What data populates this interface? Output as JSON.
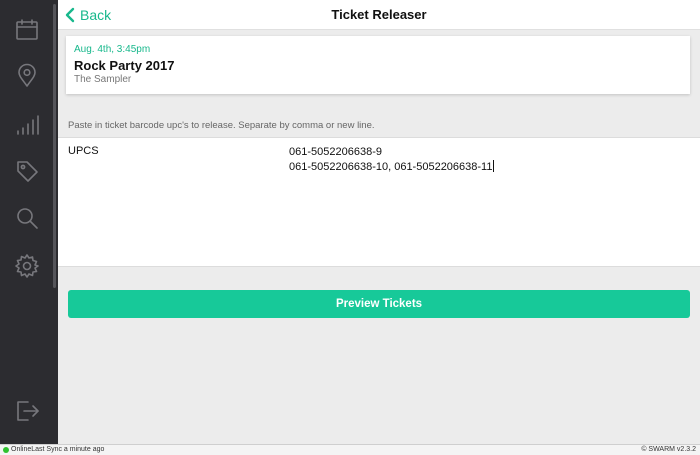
{
  "header": {
    "back_label": "Back",
    "title": "Ticket Releaser"
  },
  "event": {
    "date": "Aug. 4th, 3:45pm",
    "name": "Rock Party 2017",
    "venue": "The Sampler"
  },
  "upc": {
    "instructions": "Paste in ticket barcode upc's to release. Separate by comma or new line.",
    "label": "UPCS",
    "lines": [
      "061-5052206638-9",
      "061-5052206638-10, 061-5052206638-11"
    ]
  },
  "actions": {
    "preview_label": "Preview Tickets"
  },
  "status": {
    "connection": "Online",
    "last_sync": "Last Sync a minute ago",
    "version": "© SWARM v2.3.2"
  },
  "sidebar": {
    "icons": [
      "calendar-icon",
      "location-pin-icon",
      "signal-bars-icon",
      "tag-icon",
      "search-icon",
      "gear-icon",
      "logout-icon"
    ]
  },
  "colors": {
    "accent": "#17c999",
    "sidebar_bg": "#2c2c30",
    "online_dot": "#2fc22f"
  }
}
